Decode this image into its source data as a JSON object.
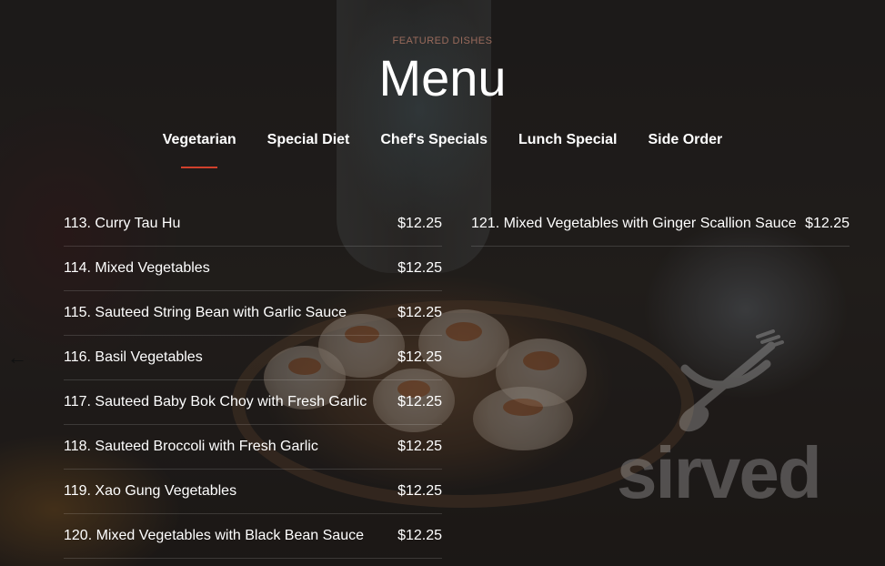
{
  "header": {
    "eyebrow": "FEATURED DISHES",
    "title": "Menu"
  },
  "tabs": [
    {
      "label": "Vegetarian",
      "active": true
    },
    {
      "label": "Special Diet",
      "active": false
    },
    {
      "label": "Chef's Specials",
      "active": false
    },
    {
      "label": "Lunch Special",
      "active": false
    },
    {
      "label": "Side Order",
      "active": false
    }
  ],
  "menu": {
    "left": [
      {
        "name": "113. Curry Tau Hu",
        "price": "$12.25"
      },
      {
        "name": "114. Mixed Vegetables",
        "price": "$12.25"
      },
      {
        "name": "115. Sauteed String Bean with Garlic Sauce",
        "price": "$12.25"
      },
      {
        "name": "116. Basil Vegetables",
        "price": "$12.25"
      },
      {
        "name": "117. Sauteed Baby Bok Choy with Fresh Garlic",
        "price": "$12.25"
      },
      {
        "name": "118. Sauteed Broccoli with Fresh Garlic",
        "price": "$12.25"
      },
      {
        "name": "119. Xao Gung Vegetables",
        "price": "$12.25"
      },
      {
        "name": "120. Mixed Vegetables with Black Bean Sauce",
        "price": "$12.25"
      }
    ],
    "right": [
      {
        "name": "121. Mixed Vegetables with Ginger Scallion Sauce",
        "price": "$12.25"
      }
    ]
  },
  "nav": {
    "prev_glyph": "←"
  },
  "watermark": {
    "text": "sirved",
    "icon": "fork-spoon-icon"
  },
  "colors": {
    "accent": "#d0402c",
    "eyebrow": "#9a6b5c"
  }
}
